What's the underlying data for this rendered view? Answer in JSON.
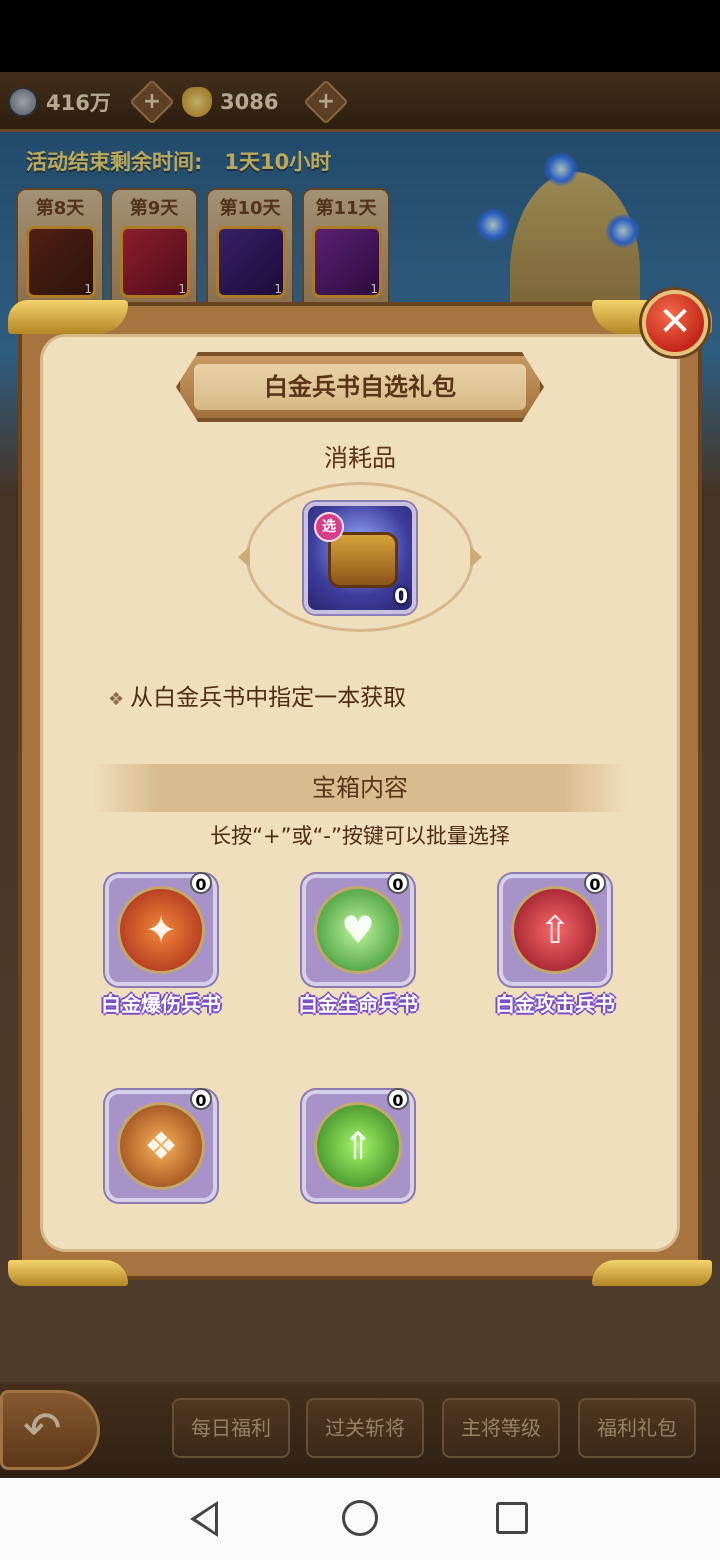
{
  "topbar": {
    "silver": {
      "amount": "416万",
      "icon": "coin-icon"
    },
    "gold": {
      "amount": "3086",
      "icon": "gold-ingot-icon"
    },
    "plus_label": "+"
  },
  "timer": {
    "label": "活动结束剩余时间:",
    "value": "1天10小时"
  },
  "day_tabs": [
    {
      "label": "第8天",
      "count": "1"
    },
    {
      "label": "第9天",
      "count": "1"
    },
    {
      "label": "第10天",
      "count": "1"
    },
    {
      "label": "第11天",
      "count": "1"
    }
  ],
  "bottom_nav": {
    "tabs": [
      "每日福利",
      "过关斩将",
      "主将等级",
      "福利礼包"
    ]
  },
  "modal": {
    "title": "白金兵书自选礼包",
    "category": "消耗品",
    "item": {
      "badge": "选",
      "quantity": "0"
    },
    "description_bullet": "❖",
    "description": "从白金兵书中指定一本获取",
    "contents_title": "宝箱内容",
    "hint": "长按“+”或“-”按键可以批量选择",
    "close_label": "✕",
    "contents": [
      {
        "name": "白金爆伤兵书",
        "quantity": "0",
        "icon": "crit-damage-book-icon",
        "color": "#d8452a"
      },
      {
        "name": "白金生命兵书",
        "quantity": "0",
        "icon": "life-book-icon",
        "color": "#3caa3a"
      },
      {
        "name": "白金攻击兵书",
        "quantity": "0",
        "icon": "attack-book-icon",
        "color": "#c8233a"
      },
      {
        "name": "",
        "quantity": "0",
        "icon": "defense-book-icon",
        "color": "#c7671e"
      },
      {
        "name": "",
        "quantity": "0",
        "icon": "speed-book-icon",
        "color": "#4bb02c"
      }
    ]
  },
  "android_nav": {
    "back": "back-icon",
    "home": "home-icon",
    "recent": "recent-apps-icon"
  }
}
